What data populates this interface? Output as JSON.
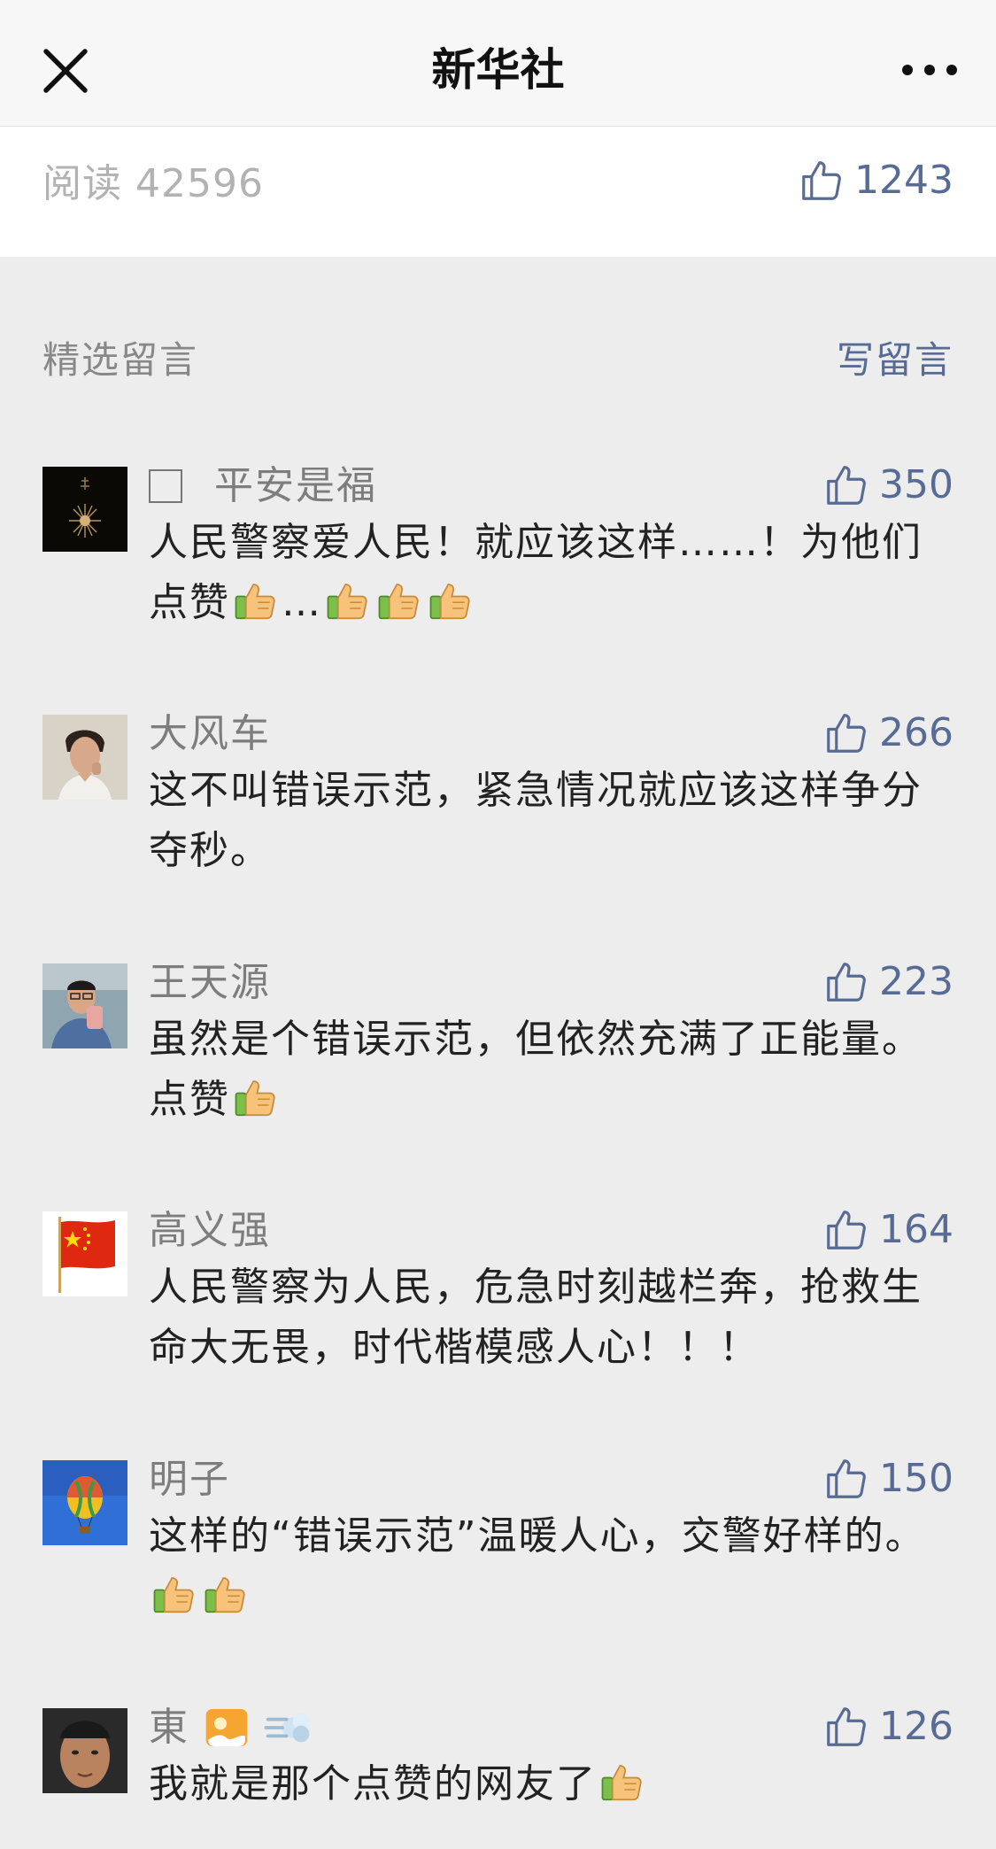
{
  "header": {
    "title": "新华社",
    "close_icon": "close-icon",
    "more_icon": "more-icon"
  },
  "stats": {
    "read_label": "阅读 42596",
    "likes": "1243"
  },
  "section": {
    "title": "精选留言",
    "write_label": "写留言"
  },
  "colors": {
    "link": "#576b95",
    "background": "#ededed",
    "text": "#222222",
    "muted": "#888888"
  },
  "comments": [
    {
      "nickname": "平安是福",
      "likes": "350",
      "text_a": "人民警察爱人民！就应该这样……！为他们点赞",
      "text_b": "…",
      "emoji": [
        "thumbs-up-icon",
        "thumbs-up-icon",
        "thumbs-up-icon",
        "thumbs-up-icon"
      ]
    },
    {
      "nickname": "大风车",
      "likes": "266",
      "text": "这不叫错误示范，紧急情况就应该这样争分夺秒。"
    },
    {
      "nickname": "王天源",
      "likes": "223",
      "text": "虽然是个错误示范，但依然充满了正能量。点赞",
      "emoji": [
        "thumbs-up-icon"
      ]
    },
    {
      "nickname": "高义强",
      "likes": "164",
      "text": "人民警察为人民，危急时刻越栏奔，抢救生命大无畏，时代楷模感人心！！！"
    },
    {
      "nickname": "明子",
      "likes": "150",
      "text": "这样的“错误示范”温暖人心，交警好样的。",
      "emoji": [
        "thumbs-up-icon",
        "thumbs-up-icon"
      ]
    },
    {
      "nickname": "東",
      "nick_emoji": [
        "sunset-picture-icon",
        "dash-icon"
      ],
      "likes": "126",
      "text": "我就是那个点赞的网友了",
      "emoji": [
        "thumbs-up-icon"
      ]
    }
  ]
}
